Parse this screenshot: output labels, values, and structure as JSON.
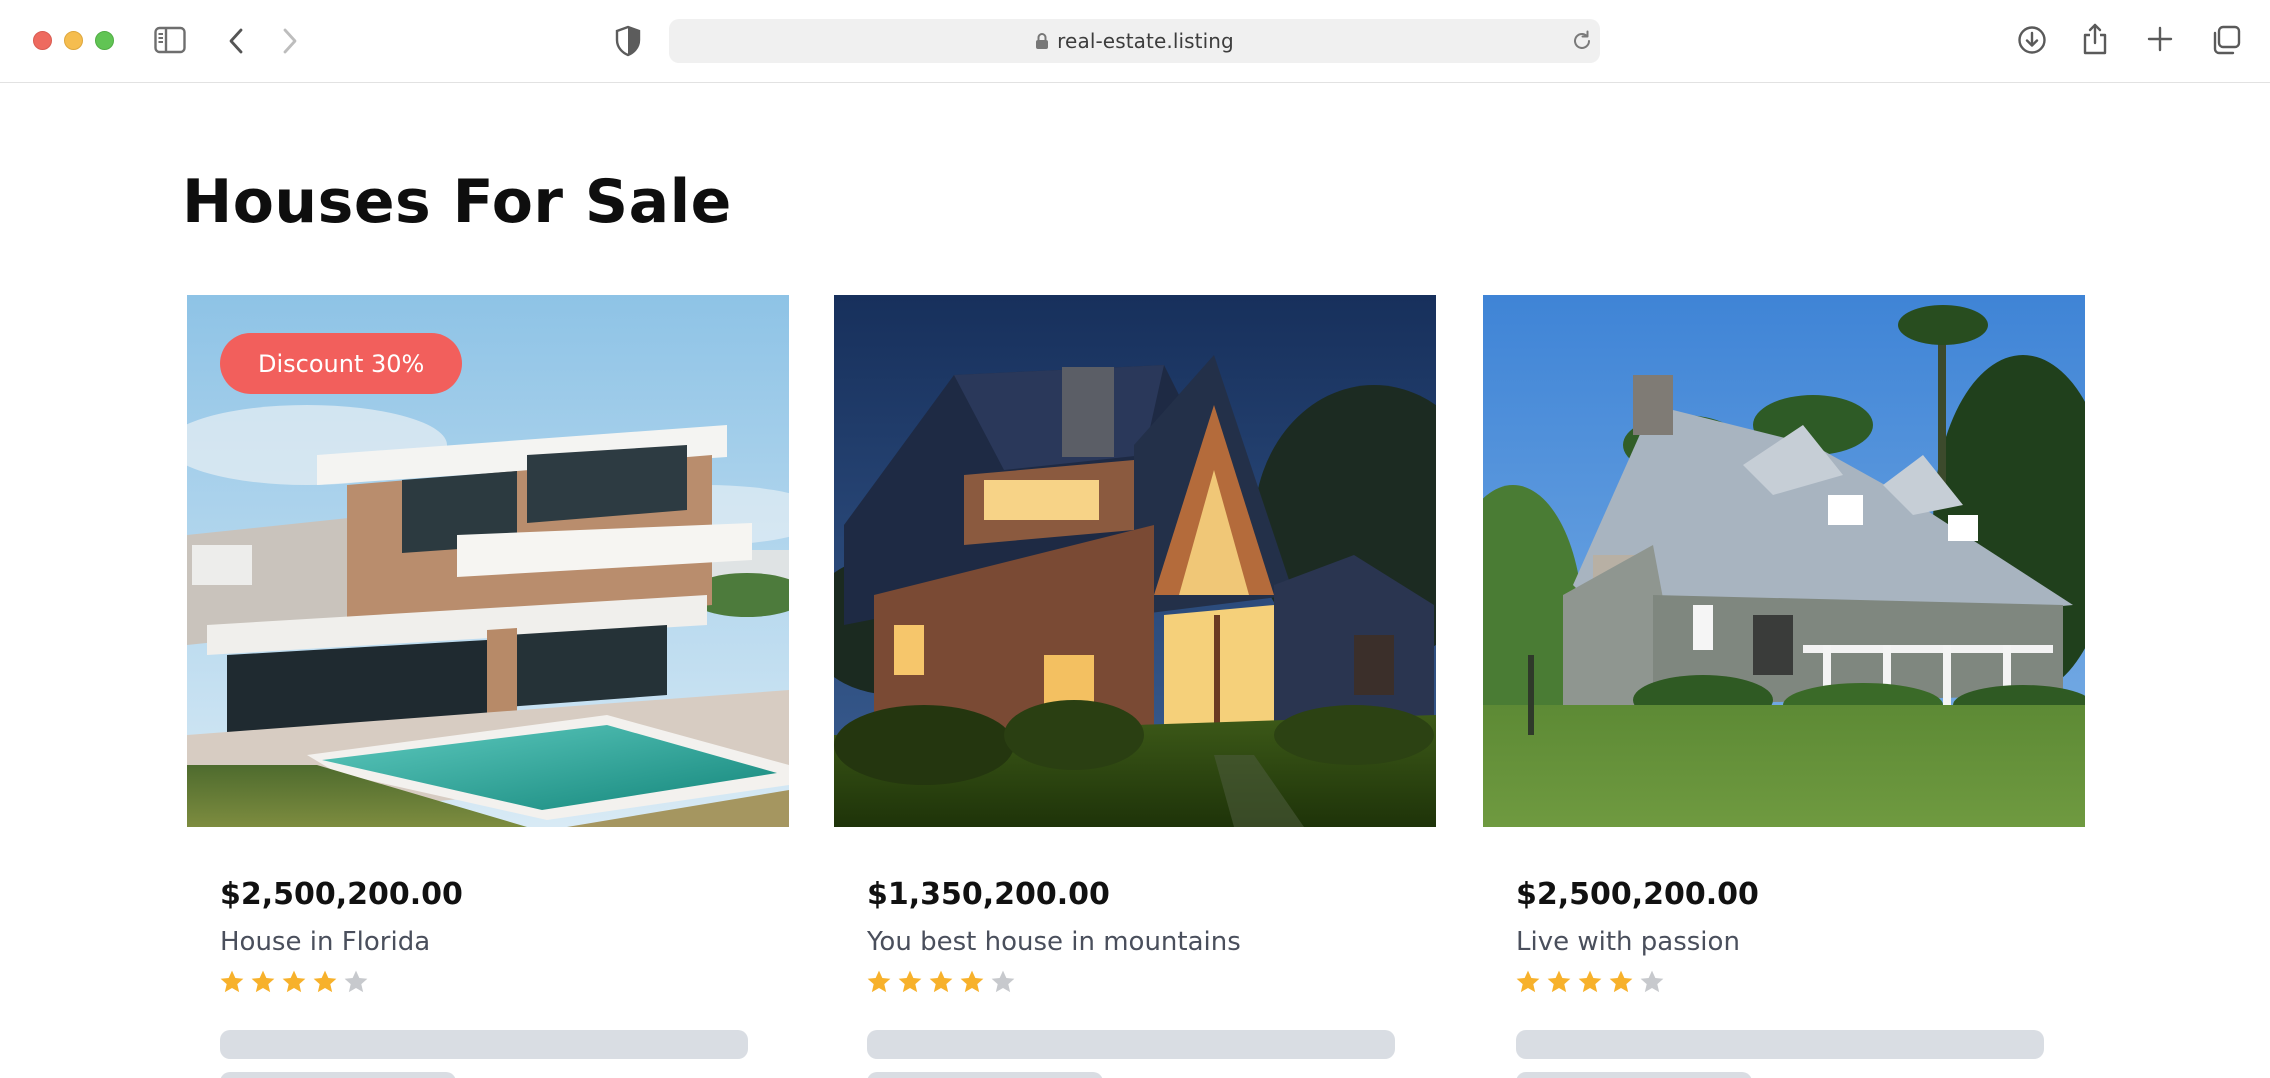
{
  "browser": {
    "url": "real-estate.listing",
    "icons": [
      "sidebar-icon",
      "back-icon",
      "forward-icon",
      "shield-icon",
      "lock-icon",
      "reload-icon",
      "download-icon",
      "share-icon",
      "new-tab-icon",
      "tabs-overview-icon"
    ]
  },
  "page": {
    "title": "Houses For Sale"
  },
  "listings": [
    {
      "badge": "Discount 30%",
      "price": "$2,500,200.00",
      "name": "House in Florida",
      "rating": 4,
      "rating_max": 5
    },
    {
      "price": "$1,350,200.00",
      "name": "You best house in mountains",
      "rating": 4,
      "rating_max": 5
    },
    {
      "price": "$2,500,200.00",
      "name": "Live with passion",
      "rating": 4,
      "rating_max": 5
    }
  ],
  "colors": {
    "badge": "#f25f5c",
    "star_filled": "#f7b12b",
    "star_empty": "#c7c9cd",
    "skeleton": "#d9dde3"
  }
}
